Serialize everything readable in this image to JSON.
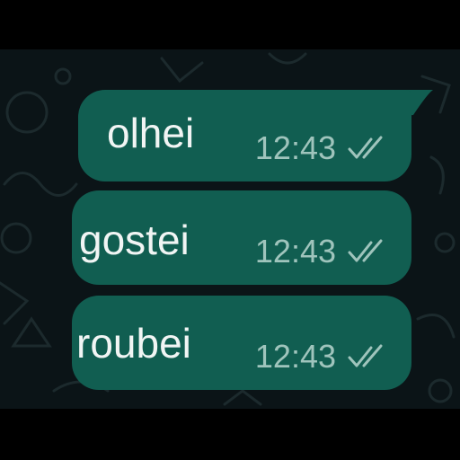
{
  "messages": [
    {
      "text": "olhei",
      "time": "12:43",
      "status_icon": "double-check-icon"
    },
    {
      "text": "gostei",
      "time": "12:43",
      "status_icon": "double-check-icon"
    },
    {
      "text": "roubei",
      "time": "12:43",
      "status_icon": "double-check-icon"
    }
  ],
  "colors": {
    "bubble": "#115e51",
    "chat_background": "#0b1417",
    "time_text": "#9fc4bc",
    "message_text": "#f1f5f4"
  }
}
